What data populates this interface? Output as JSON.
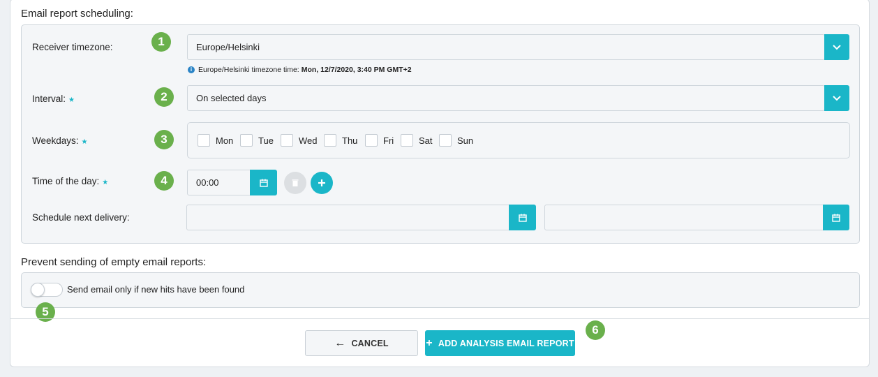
{
  "scheduling": {
    "title": "Email report scheduling:",
    "receiver_timezone": {
      "label": "Receiver timezone:",
      "value": "Europe/Helsinki",
      "hint_prefix": "Europe/Helsinki timezone time:",
      "hint_value": "Mon, 12/7/2020, 3:40 PM GMT+2",
      "badge": "1"
    },
    "interval": {
      "label": "Interval:",
      "required_mark": "★",
      "value": "On selected days",
      "badge": "2"
    },
    "weekdays": {
      "label": "Weekdays:",
      "required_mark": "★",
      "badge": "3",
      "days": [
        "Mon",
        "Tue",
        "Wed",
        "Thu",
        "Fri",
        "Sat",
        "Sun"
      ]
    },
    "time_of_day": {
      "label": "Time of the day:",
      "required_mark": "★",
      "value": "00:00",
      "badge": "4"
    },
    "next_delivery": {
      "label": "Schedule next delivery:",
      "start_value": "",
      "end_value": ""
    }
  },
  "empty_reports": {
    "title": "Prevent sending of empty email reports:",
    "toggle_label": "Send email only if new hits have been found",
    "toggle_on": false,
    "badge": "5"
  },
  "footer": {
    "cancel_label": "CANCEL",
    "add_label": "ADD ANALYSIS EMAIL REPORT",
    "badge": "6"
  },
  "colors": {
    "accent": "#1ab6c8",
    "badge": "#6ab04c",
    "info": "#2a84c6"
  },
  "icons": [
    "chevron-down-icon",
    "calendar-icon",
    "trash-icon",
    "plus-icon",
    "arrow-left-icon",
    "info-icon"
  ]
}
